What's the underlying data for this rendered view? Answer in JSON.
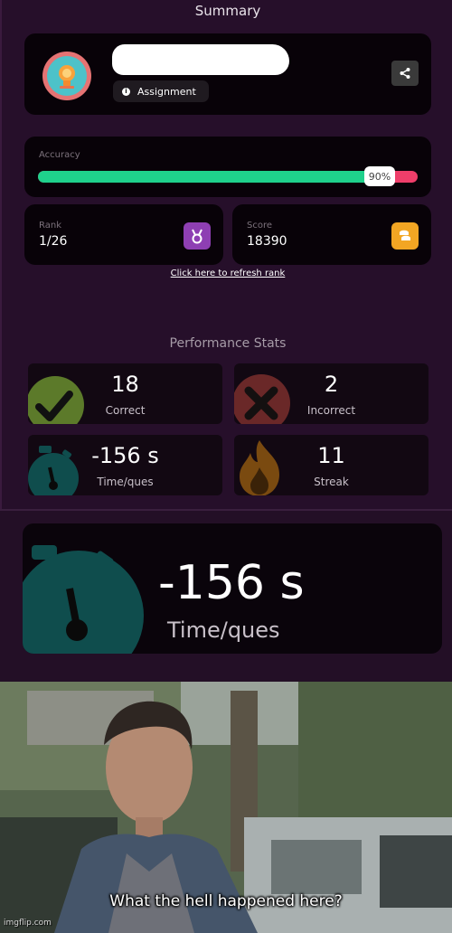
{
  "header": {
    "title": "Summary"
  },
  "quiz": {
    "tag_label": "Assignment"
  },
  "accuracy": {
    "label": "Accuracy",
    "value_text": "90%",
    "fraction": 0.9
  },
  "rank": {
    "label": "Rank",
    "value": "1/26"
  },
  "score": {
    "label": "Score",
    "value": "18390"
  },
  "refresh_link": "Click here to refresh rank",
  "performance": {
    "title": "Performance Stats",
    "correct": {
      "value": "18",
      "label": "Correct"
    },
    "incorrect": {
      "value": "2",
      "label": "Incorrect"
    },
    "time": {
      "value": "-156 s",
      "label": "Time/ques"
    },
    "streak": {
      "value": "11",
      "label": "Streak"
    }
  },
  "zoomed": {
    "value": "-156 s",
    "label": "Time/ques"
  },
  "meme": {
    "caption": "What the hell happened here?",
    "watermark": "imgflip.com"
  },
  "colors": {
    "correct_bar": "#1fd18c",
    "incorrect_bar": "#ef3e6a",
    "rank_icon": "#8e3fb3",
    "score_icon": "#f2a623",
    "correct_icon": "#5c7a2a",
    "incorrect_icon": "#6a2828",
    "time_icon": "#0f4d4d",
    "streak_icon": "#7a4a10"
  },
  "icons": [
    "lightbulb-avatar-icon",
    "info-icon",
    "share-icon",
    "medal-icon",
    "coins-icon",
    "checkmark-icon",
    "cross-icon",
    "stopwatch-icon",
    "flame-icon"
  ]
}
